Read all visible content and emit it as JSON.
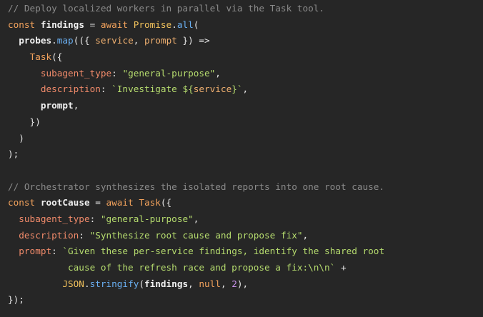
{
  "colors": {
    "background": "#262626",
    "comment": "#8a8a8a",
    "keyword": "#f2a25c",
    "string": "#b5db6e",
    "property": "#f08a6a",
    "number": "#c792ea",
    "method": "#6ab0f3",
    "text": "#e6e6e6"
  },
  "lines": [
    [
      {
        "t": "// Deploy localized workers in parallel via the Task tool.",
        "k": "comment"
      }
    ],
    [
      {
        "t": "const ",
        "k": "keyword"
      },
      {
        "t": "findings",
        "k": "ident"
      },
      {
        "t": " = ",
        "k": "punct"
      },
      {
        "t": "await ",
        "k": "keyword"
      },
      {
        "t": "Promise",
        "k": "builtin"
      },
      {
        "t": ".",
        "k": "punct"
      },
      {
        "t": "all",
        "k": "method"
      },
      {
        "t": "(",
        "k": "punct"
      }
    ],
    [
      {
        "t": "  ",
        "k": "punct"
      },
      {
        "t": "probes",
        "k": "ident"
      },
      {
        "t": ".",
        "k": "punct"
      },
      {
        "t": "map",
        "k": "method"
      },
      {
        "t": "(({ ",
        "k": "punct"
      },
      {
        "t": "service",
        "k": "param"
      },
      {
        "t": ", ",
        "k": "punct"
      },
      {
        "t": "prompt",
        "k": "param"
      },
      {
        "t": " }) =>",
        "k": "punct"
      }
    ],
    [
      {
        "t": "    ",
        "k": "punct"
      },
      {
        "t": "Task",
        "k": "call"
      },
      {
        "t": "({",
        "k": "punct"
      }
    ],
    [
      {
        "t": "      ",
        "k": "punct"
      },
      {
        "t": "subagent_type",
        "k": "prop"
      },
      {
        "t": ": ",
        "k": "punct"
      },
      {
        "t": "\"general-purpose\"",
        "k": "string"
      },
      {
        "t": ",",
        "k": "punct"
      }
    ],
    [
      {
        "t": "      ",
        "k": "punct"
      },
      {
        "t": "description",
        "k": "prop"
      },
      {
        "t": ": ",
        "k": "punct"
      },
      {
        "t": "`Investigate ${",
        "k": "string"
      },
      {
        "t": "service",
        "k": "param"
      },
      {
        "t": "}`",
        "k": "string"
      },
      {
        "t": ",",
        "k": "punct"
      }
    ],
    [
      {
        "t": "      ",
        "k": "punct"
      },
      {
        "t": "prompt",
        "k": "ident"
      },
      {
        "t": ",",
        "k": "punct"
      }
    ],
    [
      {
        "t": "    })",
        "k": "punct"
      }
    ],
    [
      {
        "t": "  )",
        "k": "punct"
      }
    ],
    [
      {
        "t": ");",
        "k": "punct"
      }
    ],
    [
      {
        "t": "",
        "k": "punct"
      }
    ],
    [
      {
        "t": "// Orchestrator synthesizes the isolated reports into one root cause.",
        "k": "comment"
      }
    ],
    [
      {
        "t": "const ",
        "k": "keyword"
      },
      {
        "t": "rootCause",
        "k": "ident"
      },
      {
        "t": " = ",
        "k": "punct"
      },
      {
        "t": "await ",
        "k": "keyword"
      },
      {
        "t": "Task",
        "k": "call"
      },
      {
        "t": "({",
        "k": "punct"
      }
    ],
    [
      {
        "t": "  ",
        "k": "punct"
      },
      {
        "t": "subagent_type",
        "k": "prop"
      },
      {
        "t": ": ",
        "k": "punct"
      },
      {
        "t": "\"general-purpose\"",
        "k": "string"
      },
      {
        "t": ",",
        "k": "punct"
      }
    ],
    [
      {
        "t": "  ",
        "k": "punct"
      },
      {
        "t": "description",
        "k": "prop"
      },
      {
        "t": ": ",
        "k": "punct"
      },
      {
        "t": "\"Synthesize root cause and propose fix\"",
        "k": "string"
      },
      {
        "t": ",",
        "k": "punct"
      }
    ],
    [
      {
        "t": "  ",
        "k": "punct"
      },
      {
        "t": "prompt",
        "k": "prop"
      },
      {
        "t": ": ",
        "k": "punct"
      },
      {
        "t": "`Given these per-service findings, identify the shared root",
        "k": "string"
      }
    ],
    [
      {
        "t": "           ",
        "k": "punct"
      },
      {
        "t": "cause of the refresh race and propose a fix:\\n\\n`",
        "k": "string"
      },
      {
        "t": " +",
        "k": "punct"
      }
    ],
    [
      {
        "t": "          ",
        "k": "punct"
      },
      {
        "t": "JSON",
        "k": "builtin"
      },
      {
        "t": ".",
        "k": "punct"
      },
      {
        "t": "stringify",
        "k": "method"
      },
      {
        "t": "(",
        "k": "punct"
      },
      {
        "t": "findings",
        "k": "ident"
      },
      {
        "t": ", ",
        "k": "punct"
      },
      {
        "t": "null",
        "k": "keyword"
      },
      {
        "t": ", ",
        "k": "punct"
      },
      {
        "t": "2",
        "k": "num"
      },
      {
        "t": "),",
        "k": "punct"
      }
    ],
    [
      {
        "t": "});",
        "k": "punct"
      }
    ]
  ]
}
